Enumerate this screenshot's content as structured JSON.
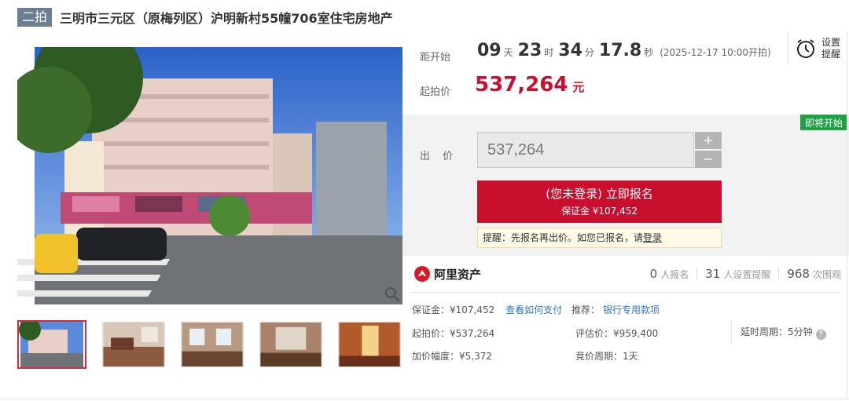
{
  "header": {
    "badge": "二拍",
    "title": "三明市三元区（原梅列区）沪明新村55幢706室住宅房地产"
  },
  "countdown": {
    "label": "距开始",
    "days": "09",
    "days_unit": "天",
    "hours": "23",
    "hours_unit": "时",
    "minutes": "34",
    "minutes_unit": "分",
    "seconds": "17.8",
    "seconds_unit": "秒",
    "start_time": "(2025-12-17 10:00开拍)"
  },
  "reminder": {
    "label": "设置提醒",
    "icon": "alarm-clock-icon"
  },
  "start_price": {
    "label": "起拍价",
    "value": "537,264",
    "unit": "元"
  },
  "bid": {
    "status_tag": "即将开始",
    "label": "出 价",
    "value": "537,264",
    "plus": "+",
    "minus": "−",
    "signup_label": "(您未登录) 立即报名",
    "deposit_label": "保证金 ¥107,452",
    "tip_text": "提醒：先报名再出价。如您已报名，请",
    "tip_link": "登录"
  },
  "platform": {
    "name": "阿里资产",
    "icon": "ali-asset-logo-icon"
  },
  "stats": [
    {
      "num": "0",
      "label": "人报名"
    },
    {
      "num": "31",
      "label": "人设置提醒"
    },
    {
      "num": "968",
      "label": "次围观"
    }
  ],
  "details": {
    "deposit": "保证金：¥107,452",
    "how_to_pay": "查看如何支付",
    "recommend_label": "推荐：",
    "bank_link": "银行专用款项",
    "start_price": "起拍价：¥537,264",
    "appraisal": "评估价：¥959,400",
    "delay": "延时周期：5分钟",
    "increment": "加价幅度：¥5,372",
    "bid_cycle": "竞价周期：1天"
  },
  "colors": {
    "accent": "#c8102e",
    "badge": "#6c7e92",
    "soon": "#21a145",
    "link": "#2f74c9"
  }
}
